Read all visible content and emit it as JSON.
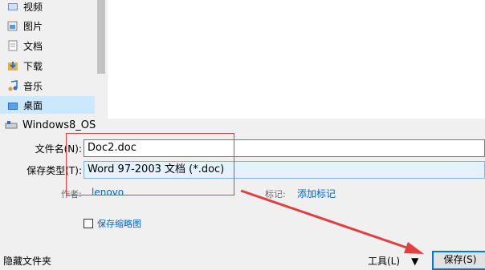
{
  "nav": {
    "items": [
      {
        "label": "视频",
        "icon": "video-folder-icon"
      },
      {
        "label": "图片",
        "icon": "pictures-folder-icon"
      },
      {
        "label": "文档",
        "icon": "documents-folder-icon"
      },
      {
        "label": "下载",
        "icon": "downloads-folder-icon"
      },
      {
        "label": "音乐",
        "icon": "music-folder-icon"
      },
      {
        "label": "桌面",
        "icon": "desktop-folder-icon"
      }
    ],
    "drive": {
      "label": "Windows8_OS",
      "icon": "drive-icon"
    }
  },
  "form": {
    "filename_label": "文件名(N):",
    "filename_value": "Doc2.doc",
    "filetype_label": "保存类型(T):",
    "filetype_value": "Word 97-2003 文档 (*.doc)",
    "author_label": "作者:",
    "author_value": "lenovo",
    "tags_label": "标记:",
    "tags_value": "添加标记",
    "thumbnail_label": "保存缩略图"
  },
  "footer": {
    "hide_folders": "隐藏文件夹",
    "tools_label": "工具(L)",
    "save_label": "保存(S)"
  },
  "colors": {
    "link": "#0066cc",
    "selected": "#cce8ff",
    "annotation": "#e04040"
  }
}
